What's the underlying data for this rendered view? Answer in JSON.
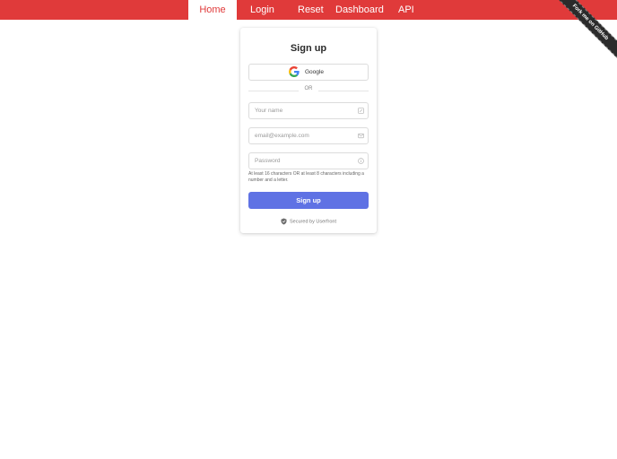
{
  "nav": {
    "items": [
      {
        "label": "Home",
        "active": true
      },
      {
        "label": "Login",
        "active": false
      },
      {
        "label": "Reset",
        "active": false
      },
      {
        "label": "Dashboard",
        "active": false
      },
      {
        "label": "API",
        "active": false
      }
    ],
    "background_color": "#e03a3a"
  },
  "ribbon": {
    "label": "Fork me on GitHub"
  },
  "form": {
    "title": "Sign up",
    "google_label": "Google",
    "separator": "OR",
    "name_placeholder": "Your name",
    "email_placeholder": "email@example.com",
    "password_placeholder": "Password",
    "password_hint": "At least 16 characters OR at least 8 characters including a number and a letter.",
    "submit_label": "Sign up",
    "submit_color": "#5f72e4",
    "secured_text": "Secured by Userfront"
  },
  "icons": {
    "google": "google-icon",
    "name_field": "edit-icon",
    "email_field": "envelope-icon",
    "password_field": "info-icon",
    "secured": "shield-icon"
  }
}
